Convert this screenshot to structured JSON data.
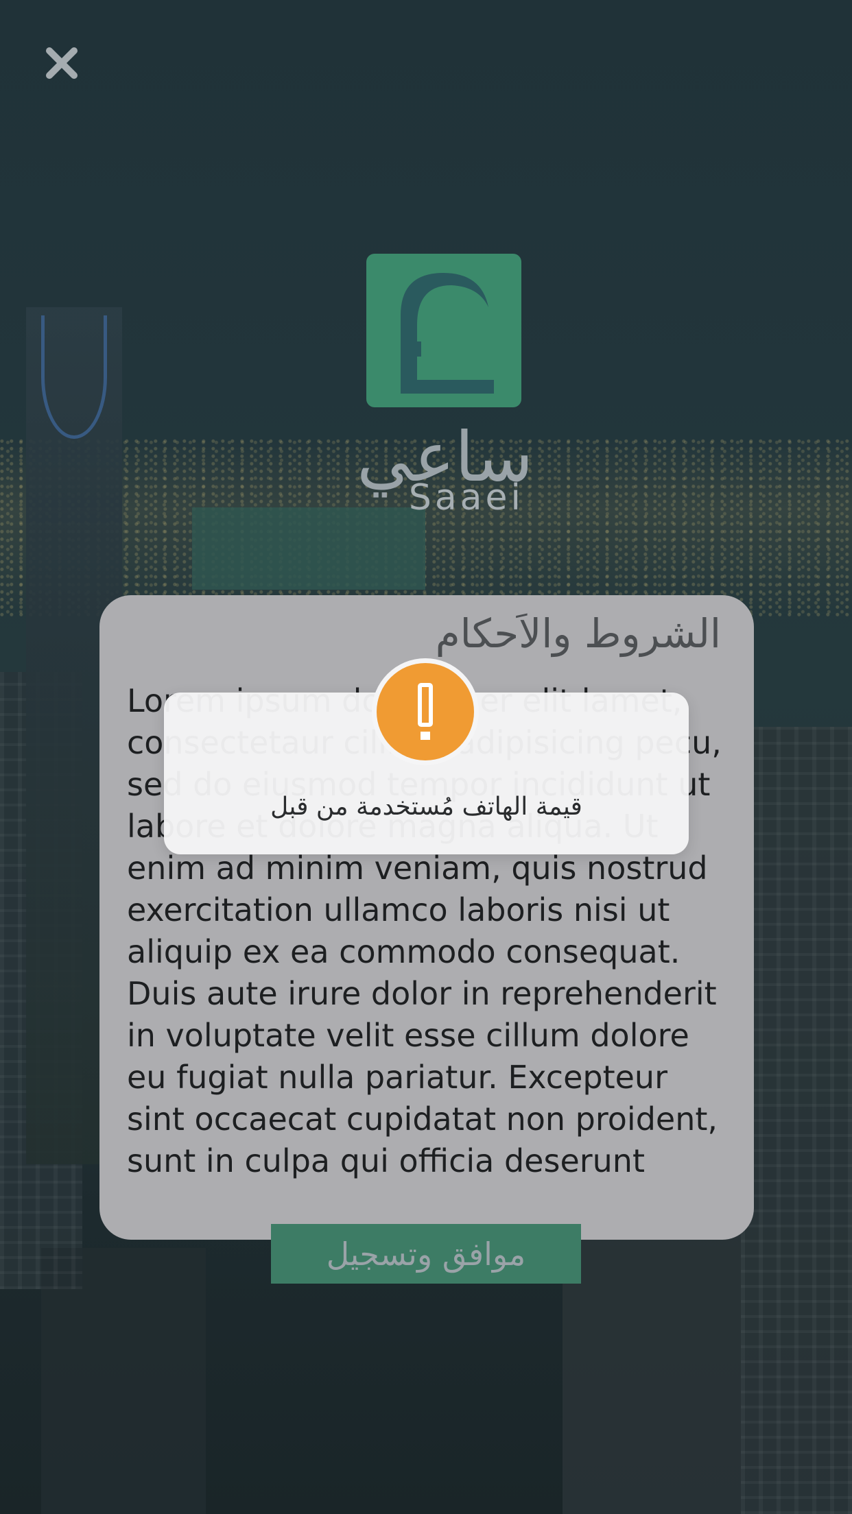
{
  "brand": {
    "name_ar": "ساعي",
    "name_en": "Saaei",
    "tile_color": "#3b8a6b"
  },
  "close": {
    "icon": "close-icon"
  },
  "terms": {
    "title": "الشروط والاَحكام",
    "body": "Lorem ipsum dolor sit er elit lamet, consectetaur cillium adipisicing pecu, sed do eiusmod tempor incididunt ut labore et dolore magna aliqua. Ut enim ad minim veniam, quis nostrud exercitation ullamco laboris nisi ut aliquip ex ea commodo consequat. Duis aute irure dolor in reprehenderit in voluptate velit esse cillum dolore eu fugiat nulla pariatur. Excepteur sint occaecat cupidatat non proident, sunt in culpa qui officia deserunt mollit"
  },
  "agree_button": {
    "label": "موافق وتسجيل"
  },
  "alert": {
    "icon": "exclamation-icon",
    "message": "قيمة الهاتف مُستخدمة من قبل",
    "accent_color": "#f09b33"
  }
}
